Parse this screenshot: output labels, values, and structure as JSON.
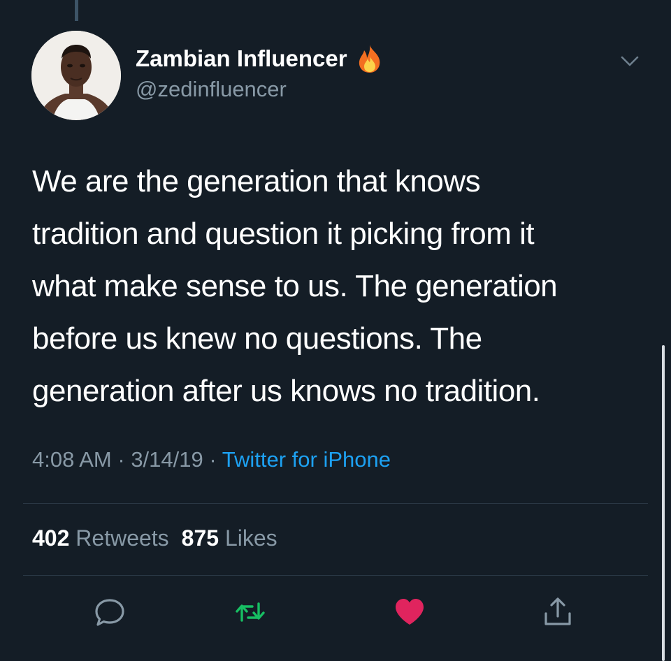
{
  "tweet": {
    "display_name": "Zambian Influencer",
    "handle": "@zedinfluencer",
    "text": "We are the generation that knows\ntradition and question it picking from it\nwhat make sense to us. The generation\nbefore us knew no questions. The\ngeneration after us knows no tradition.",
    "time": "4:08 AM",
    "date": "3/14/19",
    "source": "Twitter for iPhone",
    "separator": " · "
  },
  "stats": {
    "retweets_count": "402",
    "retweets_label": "Retweets",
    "likes_count": "875",
    "likes_label": "Likes"
  },
  "icons": {
    "name_emoji": "fire-icon",
    "menu": "chevron-down-icon",
    "actions": [
      "reply-icon",
      "retweet-icon",
      "like-icon",
      "share-icon"
    ]
  },
  "colors": {
    "background": "#141d26",
    "secondary_text": "#8899a6",
    "link": "#1da1f2",
    "retweet": "#17bf63",
    "like": "#e0245e"
  }
}
